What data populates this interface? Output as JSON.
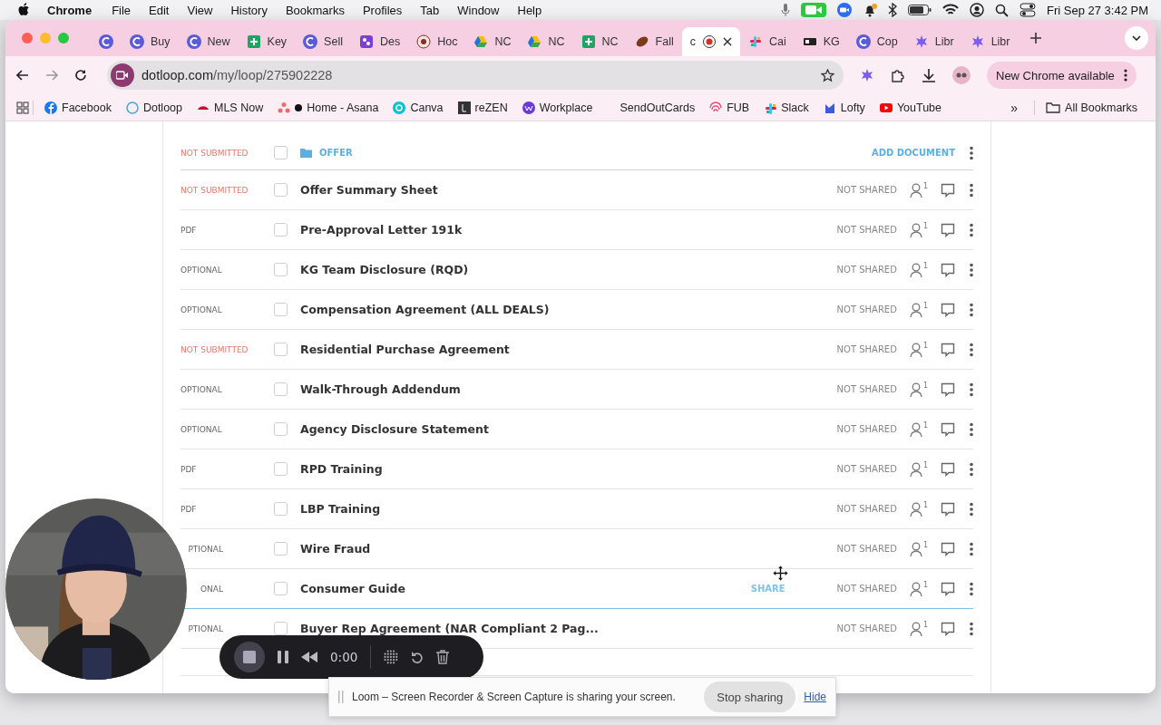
{
  "menu_bar": {
    "app": "Chrome",
    "items": [
      "File",
      "Edit",
      "View",
      "History",
      "Bookmarks",
      "Profiles",
      "Tab",
      "Window",
      "Help"
    ],
    "clock": "Fri Sep 27  3:42 PM"
  },
  "tabs": [
    {
      "selected": false
    },
    {
      "label": "Buy",
      "selected": false
    },
    {
      "label": "New",
      "selected": false
    },
    {
      "label": "Key",
      "selected": false
    },
    {
      "label": "Sell",
      "selected": false
    },
    {
      "label": "Des",
      "selected": false
    },
    {
      "label": "Hoc",
      "selected": false
    },
    {
      "label": "NC",
      "selected": false
    },
    {
      "label": "NC",
      "selected": false
    },
    {
      "label": "NC",
      "selected": false
    },
    {
      "label": "Fall",
      "selected": false
    },
    {
      "label": "c",
      "selected": true
    },
    {
      "label": "Cai",
      "selected": false
    },
    {
      "label": "KG",
      "selected": false
    },
    {
      "label": "Cop",
      "selected": false
    },
    {
      "label": "Libr",
      "selected": false
    },
    {
      "label": "Libr",
      "selected": false
    }
  ],
  "address_bar": {
    "host": "dotloop.com",
    "path": "/my/loop/275902228"
  },
  "update_button": "New Chrome available",
  "bookmarks": [
    "Facebook",
    "Dotloop",
    "MLS Now",
    "Home - Asana",
    "Canva",
    "reZEN",
    "Workplace",
    "SendOutCards",
    "FUB",
    "Slack",
    "Lofty",
    "YouTube"
  ],
  "bookmarks_more": "»",
  "all_bookmarks": "All Bookmarks",
  "folder_header": {
    "status": "NOT SUBMITTED",
    "checked": false,
    "folder": "OFFER",
    "action": "ADD DOCUMENT"
  },
  "documents": [
    {
      "status": "NOT SUBMITTED",
      "flagged": true,
      "covered": false,
      "checked": false,
      "name": "Offer Summary Sheet",
      "sharing": "NOT SHARED",
      "viewer_count": "1",
      "hovered": false
    },
    {
      "status": "PDF",
      "flagged": false,
      "covered": false,
      "checked": false,
      "name": "Pre-Approval Letter 191k",
      "sharing": "NOT SHARED",
      "viewer_count": "1",
      "hovered": false
    },
    {
      "status": "OPTIONAL",
      "flagged": false,
      "covered": false,
      "checked": false,
      "name": "KG Team Disclosure (RQD)",
      "sharing": "NOT SHARED",
      "viewer_count": "1",
      "hovered": false
    },
    {
      "status": "OPTIONAL",
      "flagged": false,
      "covered": false,
      "checked": false,
      "name": "Compensation Agreement (ALL DEALS)",
      "sharing": "NOT SHARED",
      "viewer_count": "1",
      "hovered": false
    },
    {
      "status": "NOT SUBMITTED",
      "flagged": true,
      "covered": false,
      "checked": false,
      "name": "Residential Purchase Agreement",
      "sharing": "NOT SHARED",
      "viewer_count": "1",
      "hovered": false
    },
    {
      "status": "OPTIONAL",
      "flagged": false,
      "covered": false,
      "checked": false,
      "name": "Walk-Through Addendum",
      "sharing": "NOT SHARED",
      "viewer_count": "1",
      "hovered": false
    },
    {
      "status": "OPTIONAL",
      "flagged": false,
      "covered": false,
      "checked": false,
      "name": "Agency Disclosure Statement",
      "sharing": "NOT SHARED",
      "viewer_count": "1",
      "hovered": false
    },
    {
      "status": "PDF",
      "flagged": false,
      "covered": false,
      "checked": false,
      "name": "RPD Training",
      "sharing": "NOT SHARED",
      "viewer_count": "1",
      "hovered": false
    },
    {
      "status": "PDF",
      "flagged": false,
      "covered": false,
      "checked": false,
      "name": "LBP Training",
      "sharing": "NOT SHARED",
      "viewer_count": "1",
      "hovered": false
    },
    {
      "status": "PTIONAL",
      "flagged": false,
      "covered": true,
      "checked": false,
      "name": "Wire Fraud",
      "sharing": "NOT SHARED",
      "viewer_count": "1",
      "hovered": false
    },
    {
      "status": "ONAL",
      "flagged": false,
      "covered": true,
      "checked": false,
      "name": "Consumer Guide",
      "share_label": "SHARE",
      "sharing": "NOT SHARED",
      "viewer_count": "1",
      "hovered": true
    },
    {
      "status": "PTIONAL",
      "flagged": false,
      "covered": true,
      "checked": false,
      "name": "Buyer Rep Agreement (NAR Compliant 2 Pag...",
      "sharing": "NOT SHARED",
      "viewer_count": "1",
      "hovered": false
    }
  ],
  "recorder": {
    "timer": "0:00"
  },
  "sharing_notice": {
    "message": "Loom – Screen Recorder & Screen Capture is sharing your screen.",
    "stop_button": "Stop sharing",
    "hide_link": "Hide"
  }
}
